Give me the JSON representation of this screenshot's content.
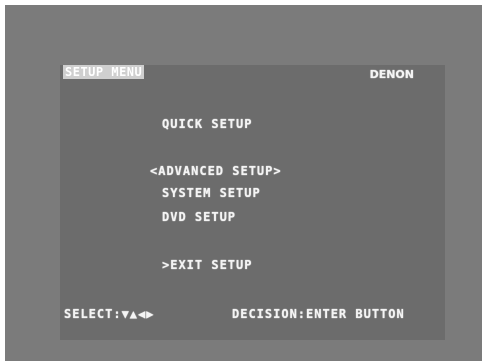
{
  "menu": {
    "title": "SETUP MENU",
    "brand": "DENON",
    "items": [
      {
        "label": "QUICK SETUP"
      },
      {
        "label": "<ADVANCED SETUP>"
      },
      {
        "label": "SYSTEM SETUP"
      },
      {
        "label": "DVD SETUP"
      },
      {
        "label": ">EXIT SETUP"
      }
    ]
  },
  "footer": {
    "select_hint": "SELECT:▼▲◀▶",
    "decision_hint": "DECISION:ENTER BUTTON"
  },
  "colors": {
    "background": "#7b7b7b",
    "text": "#f4f4f4"
  }
}
